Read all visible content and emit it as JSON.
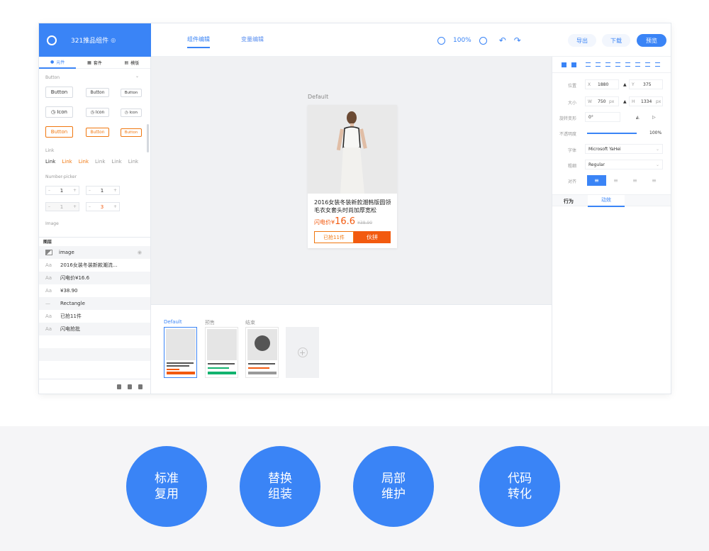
{
  "brand": {
    "name": "321推品组件",
    "sub": "◎"
  },
  "topbar": {
    "tabs": [
      "组件编辑",
      "变量编辑"
    ],
    "zoom": "100%",
    "export": "导出",
    "download": "下载",
    "preview": "预览"
  },
  "left": {
    "tabs": [
      "元件",
      "套件",
      "模版"
    ],
    "section_button": "Button",
    "btn_labels": [
      "Button",
      "Button",
      "Button"
    ],
    "icon_labels": [
      "Icon",
      "Icon",
      "Icon"
    ],
    "section_link": "Link",
    "links": [
      "Link",
      "Link",
      "Link",
      "Link",
      "Link",
      "Link"
    ],
    "section_number": "Number-picker",
    "stepper_values": [
      "1",
      "1",
      "1",
      "3"
    ],
    "stepper_minus": "–",
    "stepper_plus": "+",
    "section_image": "Image",
    "layers_title": "图层",
    "layers": [
      {
        "icon": "image",
        "label": "image"
      },
      {
        "icon": "Aa",
        "label": "2016女装冬装新款潮流..."
      },
      {
        "icon": "Aa",
        "label": "闪电价¥16.6"
      },
      {
        "icon": "Aa",
        "label": "¥38.90"
      },
      {
        "icon": "—",
        "label": "Rectangle"
      },
      {
        "icon": "Aa",
        "label": "已抢11件"
      },
      {
        "icon": "Aa",
        "label": "闪电抢批"
      }
    ]
  },
  "canvas": {
    "state_label": "Default",
    "product_title": "2016女装冬装新款潮韩版圆领毛衣女套头时尚加厚宽松",
    "price_prefix": "闪电价¥",
    "price": "16.6",
    "old_price": "¥38.90",
    "btn_sold": "已抢11件",
    "btn_buy": "伙拼"
  },
  "states": {
    "labels": [
      "Default",
      "预售",
      "结束"
    ]
  },
  "right": {
    "position_label": "位置",
    "x_label": "X",
    "x": "1880",
    "y_label": "Y",
    "y": "375",
    "size_label": "大小",
    "w_label": "W",
    "w": "750",
    "h_label": "H",
    "h": "1334",
    "unit": "px",
    "rotate_label": "旋转变形",
    "rotate": "0°",
    "opacity_label": "不透明度",
    "opacity": "100%",
    "font_label": "字体",
    "font": "Microsoft YaHei",
    "weight_label": "粗细",
    "weight": "Regular",
    "align_label": "对齐",
    "tab_behavior": "行为",
    "tab_anim": "动效"
  },
  "features": [
    {
      "l1": "标准",
      "l2": "复用"
    },
    {
      "l1": "替换",
      "l2": "组装"
    },
    {
      "l1": "局部",
      "l2": "维护"
    },
    {
      "l1": "代码",
      "l2": "转化"
    }
  ],
  "colors": {
    "accent": "#3a84f6",
    "orange": "#f25a0f",
    "green": "#12b36e"
  }
}
